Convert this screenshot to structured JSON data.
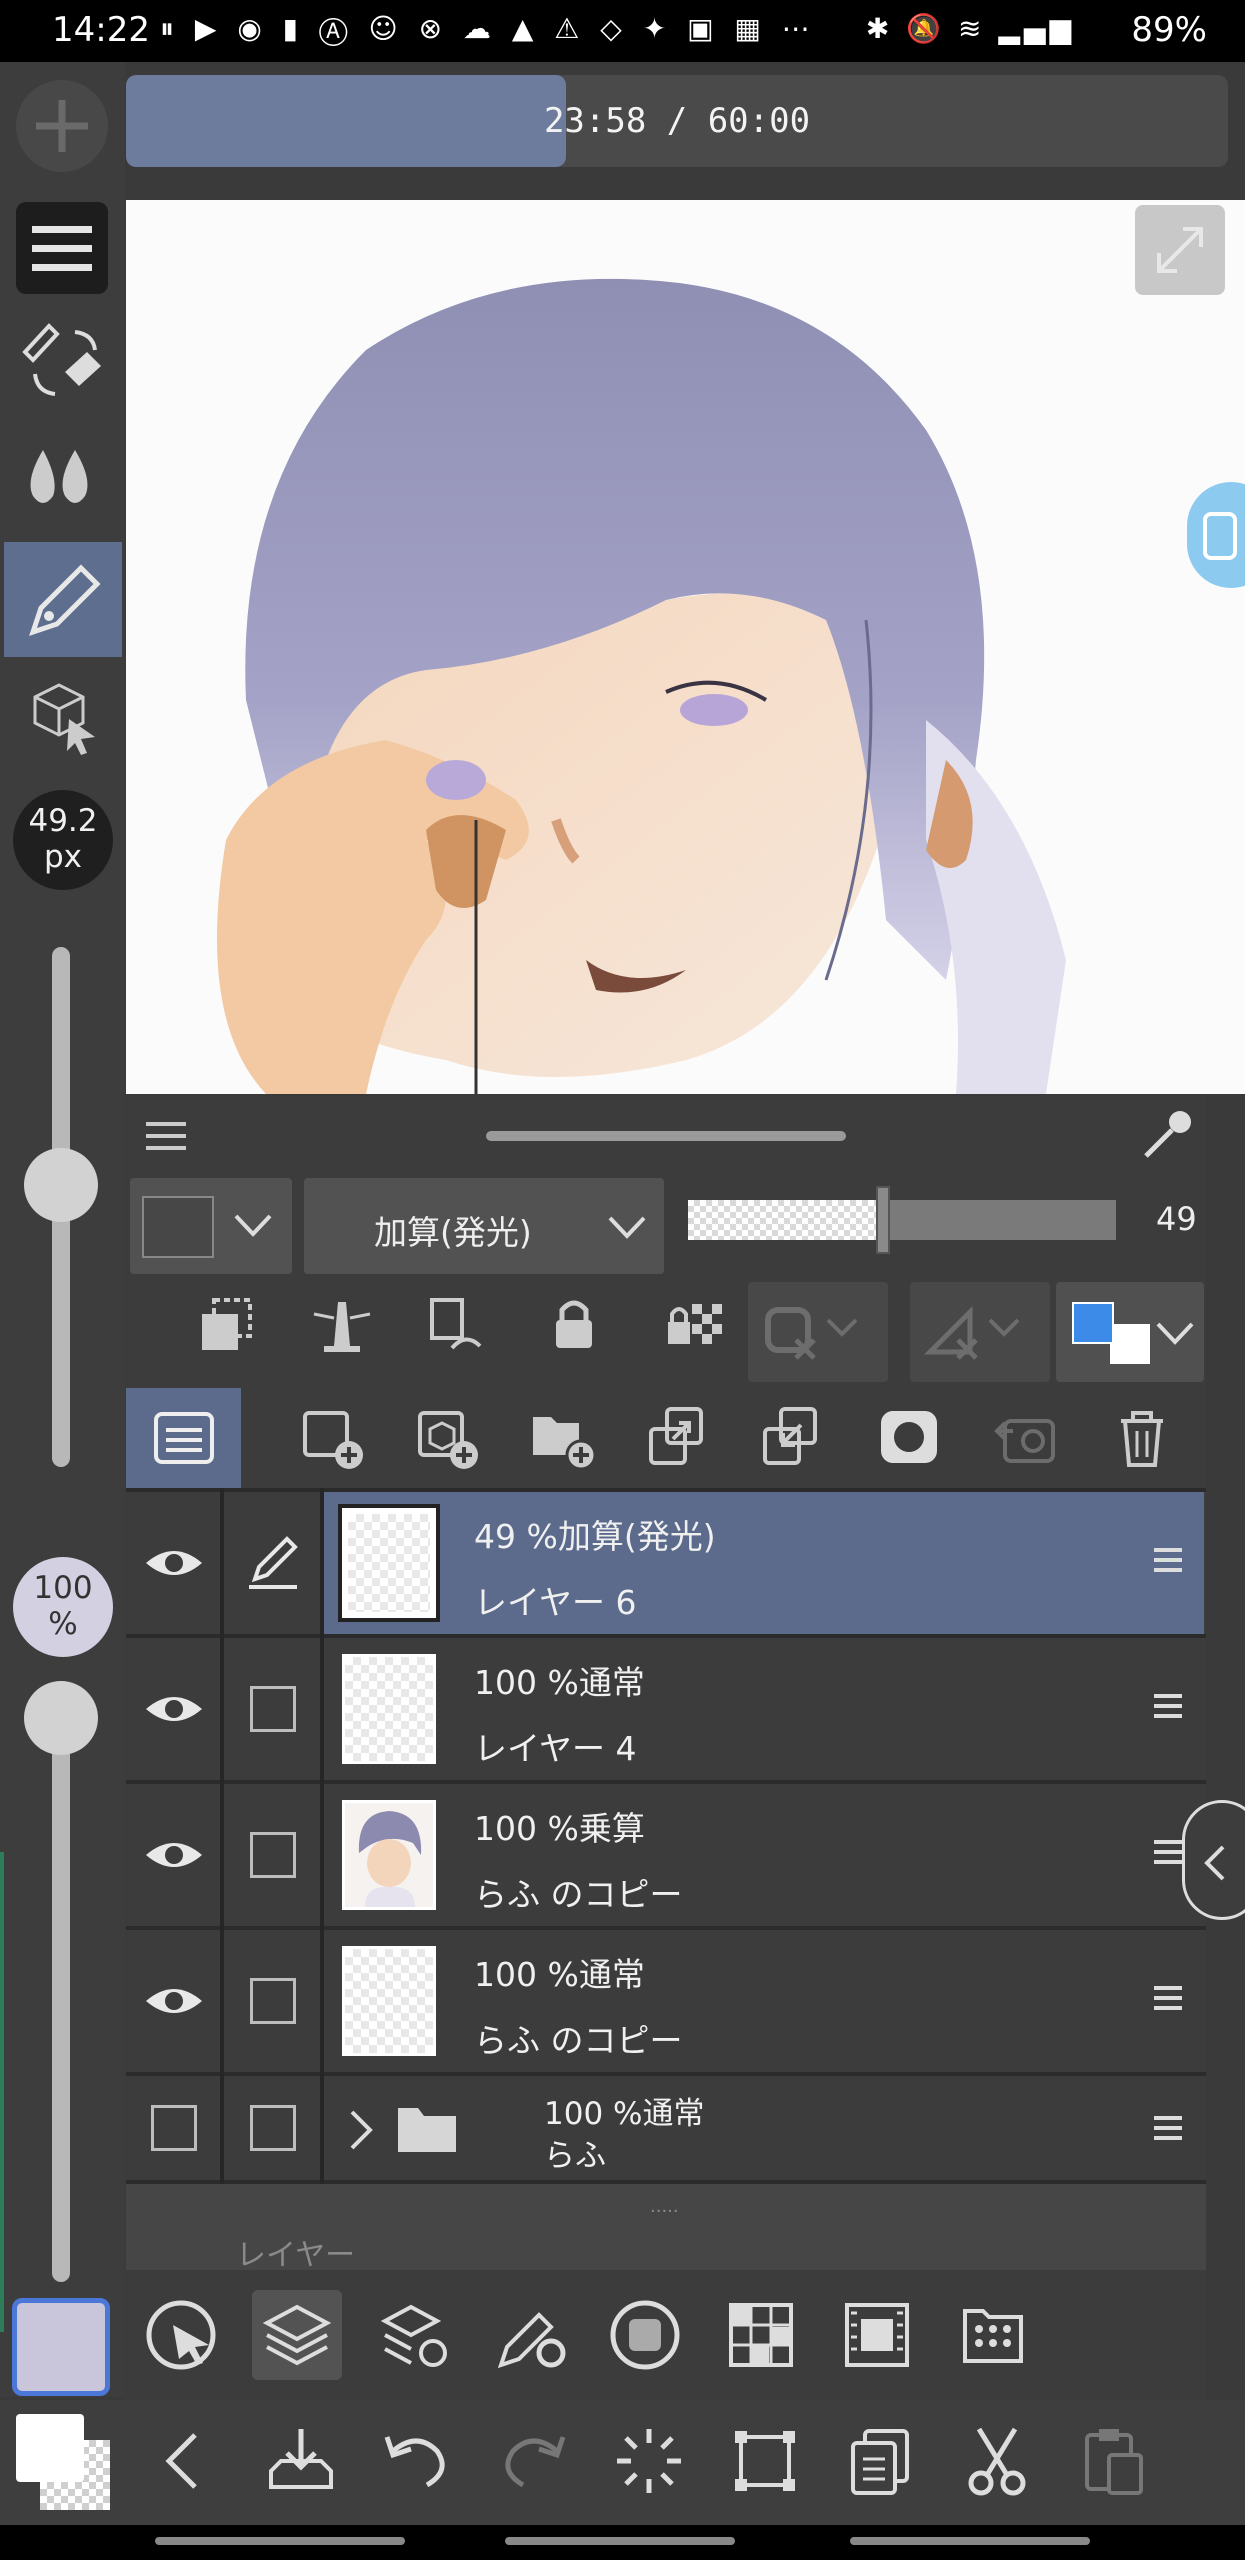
{
  "status_bar": {
    "time": "14:22",
    "battery": "89%",
    "notification_icons": [
      "pause-icon",
      "youtube-icon",
      "line-icon",
      "app-icon",
      "app-icon",
      "app-icon",
      "app-icon",
      "cloud-icon",
      "mountain-icon",
      "warning-icon",
      "screen-rotate-icon",
      "twitter-icon",
      "app-icon",
      "app-icon",
      "more-icon"
    ]
  },
  "left_toolbar": {
    "brush_size": "49.2\npx",
    "brush_size_line1": "49.2",
    "brush_size_line2": "px",
    "opacity_line1": "100",
    "opacity_line2": "%",
    "brush_size_level": 0.6,
    "opacity_level": 1.0,
    "main_color": "#c9c6dc",
    "sub_color": "#ffffff"
  },
  "timer": {
    "text": "23:58 / 60:00",
    "progress": 0.3997
  },
  "layer_panel": {
    "blend_mode": "加算(発光)",
    "opacity_value": "49",
    "opacity_level": 0.49,
    "layers": [
      {
        "line1": "49 %加算(発光)",
        "line2": "レイヤー 6",
        "selected": true,
        "visible": true,
        "editing": true
      },
      {
        "line1": "100 %通常",
        "line2": "レイヤー 4",
        "selected": false,
        "visible": true
      },
      {
        "line1": "100 %乗算",
        "line2": "らふ のコピー",
        "selected": false,
        "visible": true
      },
      {
        "line1": "100 %通常",
        "line2": "らふ のコピー",
        "selected": false,
        "visible": true
      },
      {
        "line1": "100 %通常",
        "line2": "らふ",
        "selected": false,
        "visible": false,
        "folder": true
      }
    ],
    "tab_label": "レイヤー",
    "drag_dots": "....."
  },
  "colors": {
    "accent": "#5c6b8c",
    "timer_fill": "#6d7c9c",
    "swatch_blue": "#3d8be8"
  }
}
